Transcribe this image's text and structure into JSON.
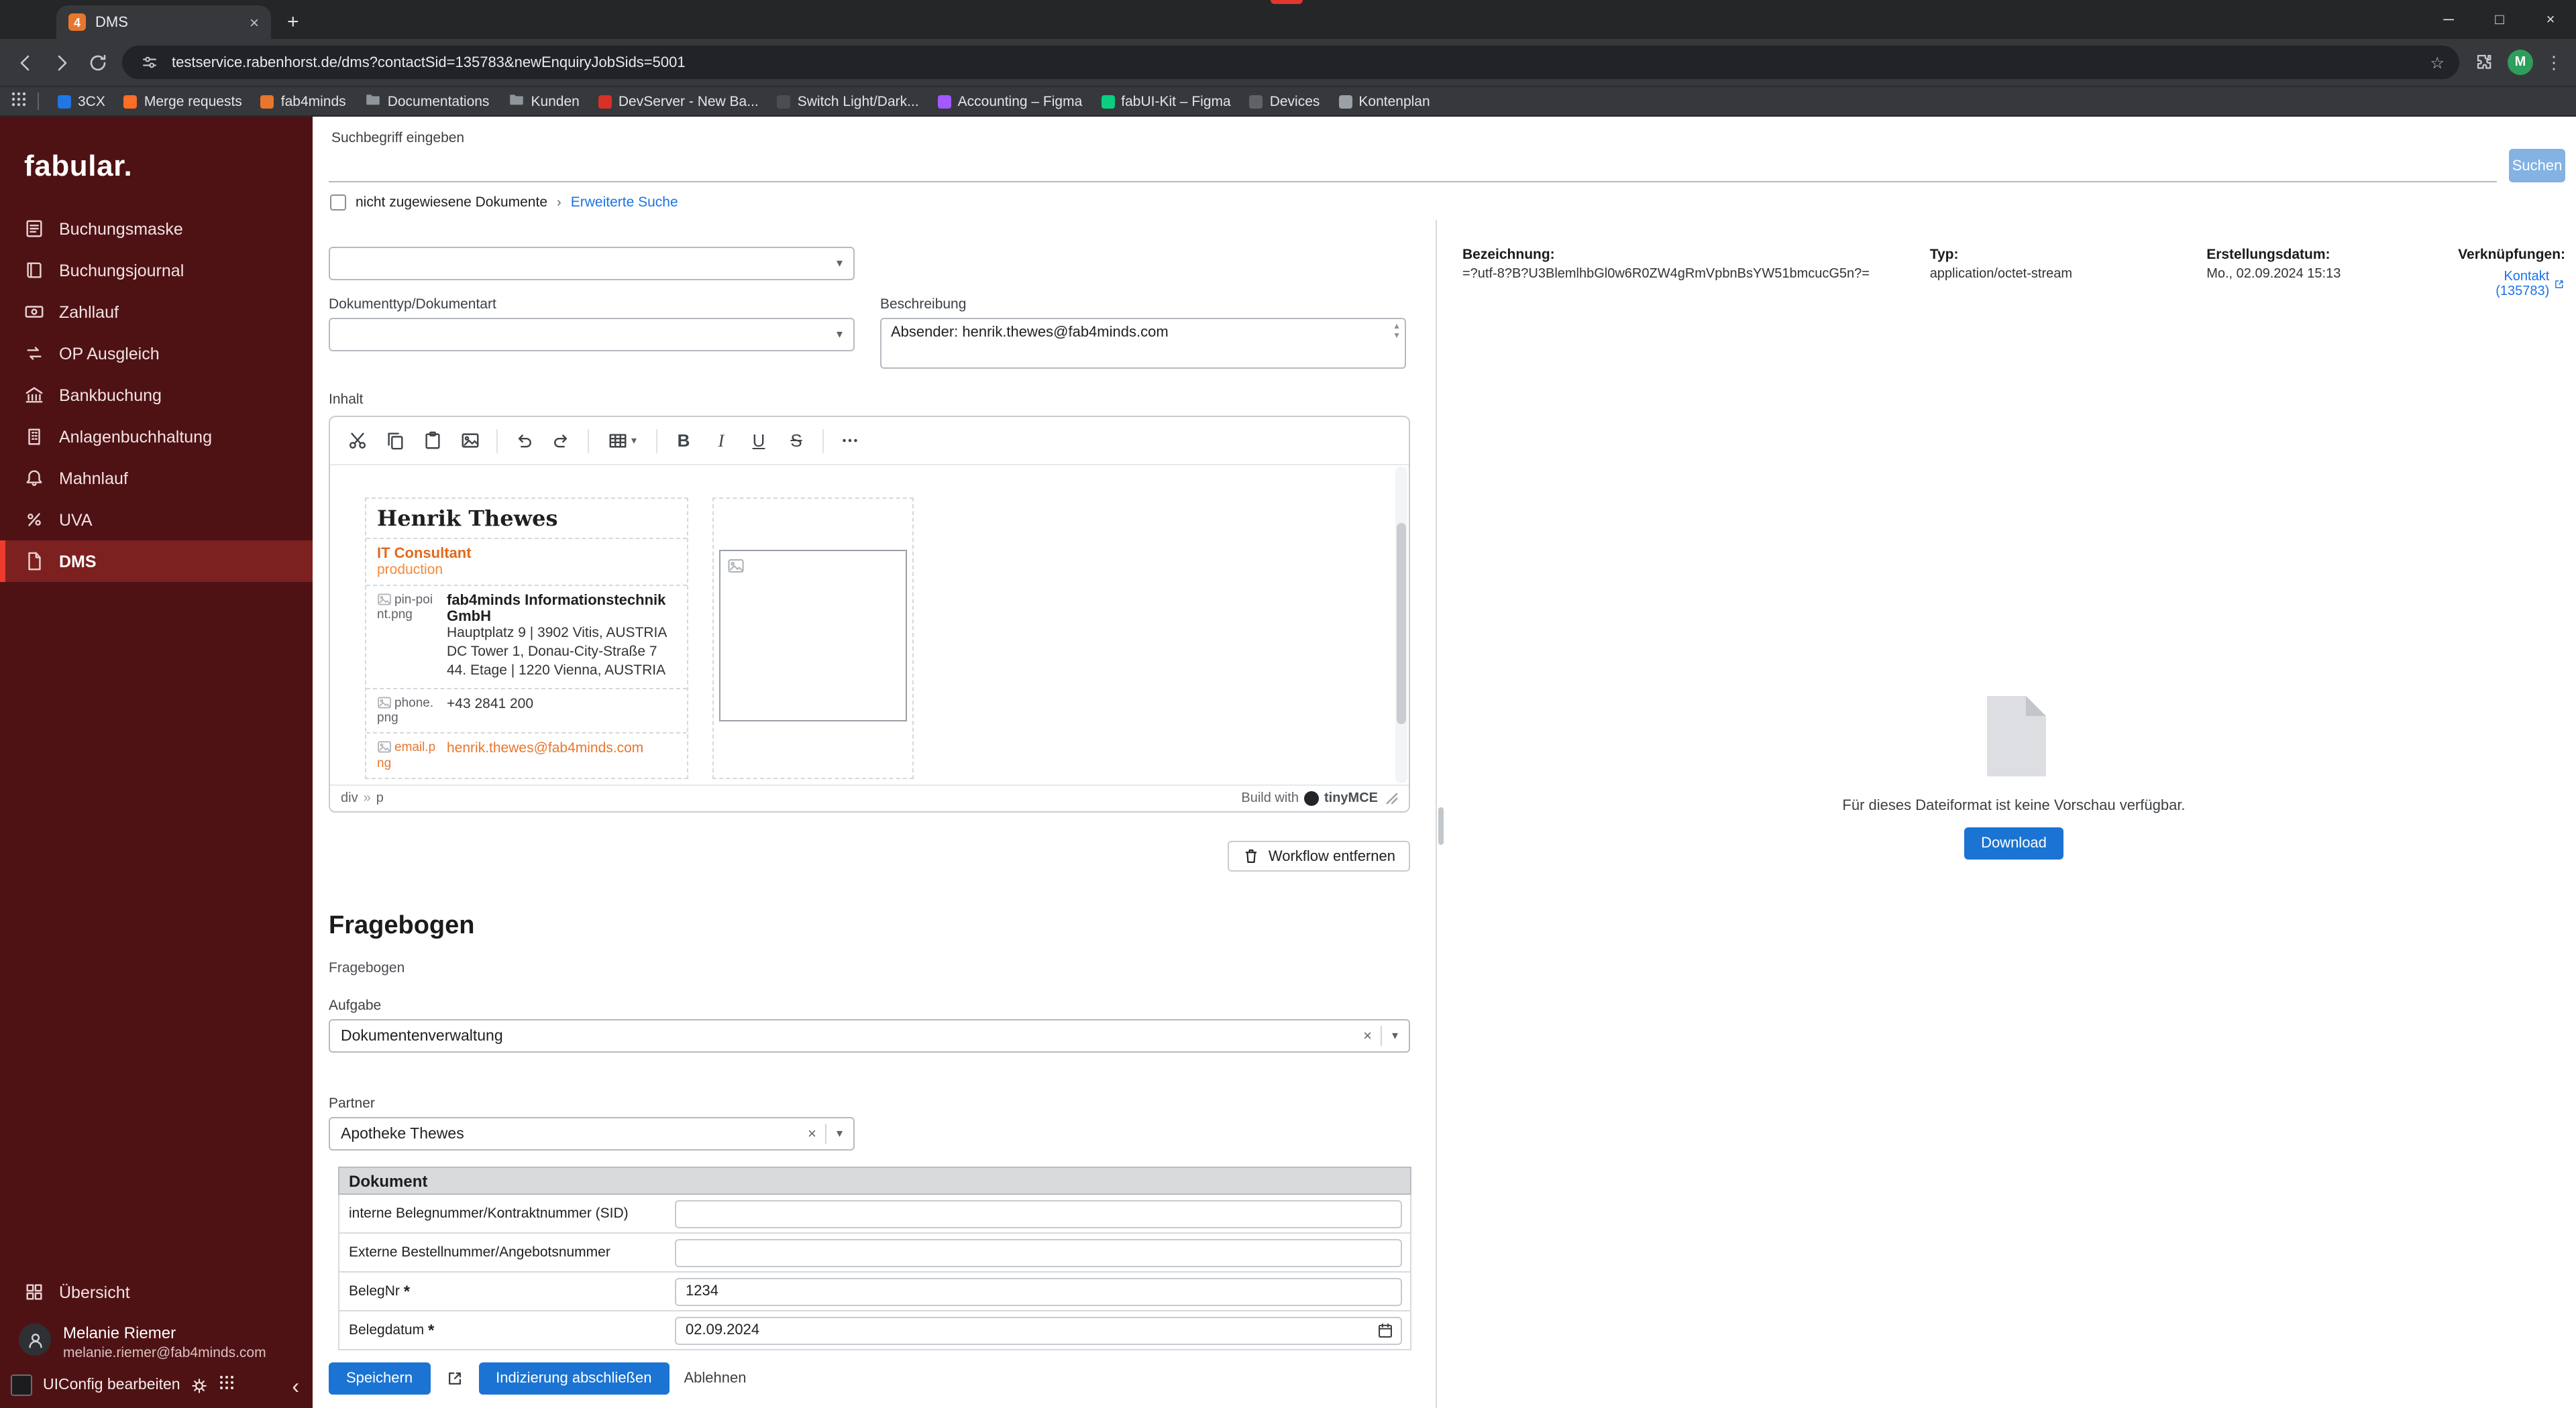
{
  "colors": {
    "sidebar_bg": "#4f1214",
    "sidebar_active_bg": "#7d2020",
    "accent_red": "#ee3b2f",
    "primary_blue": "#1b74d3",
    "link_blue": "#1a73e8",
    "signature_orange": "#e8762d",
    "chrome_dark": "#37383c"
  },
  "browser": {
    "tab_title": "DMS",
    "url": "testservice.rabenhorst.de/dms?contactSid=135783&newEnquiryJobSids=5001",
    "avatar_initial": "M",
    "favicon_letter": "4",
    "bookmarks": [
      {
        "label": "3CX",
        "color": "#2076e4",
        "icon": "site-icon"
      },
      {
        "label": "Merge requests",
        "color": "#fc6d26",
        "icon": "site-icon"
      },
      {
        "label": "fab4minds",
        "color": "#e8762d",
        "icon": "site-icon"
      },
      {
        "label": "Documentations",
        "color": "#8f959b",
        "icon": "folder-icon"
      },
      {
        "label": "Kunden",
        "color": "#8f959b",
        "icon": "folder-icon"
      },
      {
        "label": "DevServer - New Ba...",
        "color": "#d93025",
        "icon": "site-icon"
      },
      {
        "label": "Switch Light/Dark...",
        "color": "#4a4d52",
        "icon": "site-icon"
      },
      {
        "label": "Accounting – Figma",
        "color": "#a259ff",
        "icon": "site-icon"
      },
      {
        "label": "fabUI-Kit – Figma",
        "color": "#0acf83",
        "icon": "site-icon"
      },
      {
        "label": "Devices",
        "color": "#5f6368",
        "icon": "site-icon"
      },
      {
        "label": "Kontenplan",
        "color": "#9aa0a6",
        "icon": "site-icon"
      }
    ]
  },
  "sidebar": {
    "logo": "fabular.",
    "items": [
      {
        "label": "Buchungsmaske",
        "icon": "form-icon"
      },
      {
        "label": "Buchungsjournal",
        "icon": "journal-icon"
      },
      {
        "label": "Zahllauf",
        "icon": "payment-icon"
      },
      {
        "label": "OP Ausgleich",
        "icon": "balance-icon"
      },
      {
        "label": "Bankbuchung",
        "icon": "bank-icon"
      },
      {
        "label": "Anlagenbuchhaltung",
        "icon": "assets-icon"
      },
      {
        "label": "Mahnlauf",
        "icon": "bell-icon"
      },
      {
        "label": "UVA",
        "icon": "percent-icon"
      },
      {
        "label": "DMS",
        "icon": "file-icon"
      }
    ],
    "overview_label": "Übersicht",
    "user": {
      "name": "Melanie Riemer",
      "email": "melanie.riemer@fab4minds.com"
    },
    "uiconfig_label": "UIConfig bearbeiten"
  },
  "search": {
    "label": "Suchbegriff eingeben",
    "button_label": "Suchen",
    "unassigned_label": "nicht zugewiesene Dokumente",
    "advanced_label": "Erweiterte Suche"
  },
  "form": {
    "doc_type_label": "Dokumenttyp/Dokumentart",
    "description_label": "Beschreibung",
    "description_value": "Absender: henrik.thewes@fab4minds.com",
    "content_label": "Inhalt"
  },
  "editor": {
    "toolbar_icons": [
      "cut",
      "copy",
      "paste",
      "insert-image",
      "undo",
      "redo",
      "table",
      "bold",
      "italic",
      "underline",
      "strikethrough",
      "more-options"
    ],
    "signature": {
      "name": "Henrik Thewes",
      "role": "IT Consultant",
      "team": "production",
      "pin_alt": "pin-point.png",
      "company": "fab4minds Informationstechnik GmbH",
      "address1": "Hauptplatz 9 | 3902 Vitis, AUSTRIA",
      "address2": "DC Tower 1, Donau-City-Straße 7",
      "address3": "44. Etage | 1220 Vienna, AUSTRIA",
      "phone_alt": "phone.png",
      "phone": "+43 2841 200",
      "email_alt": "email.png",
      "email": "henrik.thewes@fab4minds.com"
    },
    "element_path": [
      "div",
      "p"
    ],
    "path_separator": "»",
    "branding_prefix": "Build with",
    "branding_name": "tinyMCE"
  },
  "workflow": {
    "remove_label": "Workflow entfernen"
  },
  "questionnaire": {
    "heading": "Fragebogen",
    "sub_label": "Fragebogen",
    "task_label": "Aufgabe",
    "task_value": "Dokumentenverwaltung",
    "partner_label": "Partner",
    "partner_value": "Apotheke Thewes"
  },
  "document_section": {
    "heading": "Dokument",
    "rows": [
      {
        "label": "interne Belegnummer/Kontraktnummer (SID)",
        "value": "",
        "required_mark": ""
      },
      {
        "label": "Externe Bestellnummer/Angebotsnummer",
        "value": "",
        "required_mark": ""
      },
      {
        "label": "BelegNr",
        "value": "1234",
        "required_mark": "*"
      },
      {
        "label": "Belegdatum",
        "value": "02.09.2024",
        "required_mark": "*"
      }
    ]
  },
  "actions": {
    "save": "Speichern",
    "complete_indexing": "Indizierung abschließen",
    "reject": "Ablehnen"
  },
  "preview": {
    "meta": [
      {
        "label": "Bezeichnung:",
        "value": "=?utf-8?B?U3BlemlhbGl0w6R0ZW4gRmVpbnBsYW51bmcucG5n?="
      },
      {
        "label": "Typ:",
        "value": "application/octet-stream"
      },
      {
        "label": "Erstellungsdatum:",
        "value": "Mo., 02.09.2024 15:13"
      },
      {
        "label": "Verknüpfungen:",
        "value": "Kontakt (135783)"
      }
    ],
    "no_preview": "Für dieses Dateiformat ist keine Vorschau verfügbar.",
    "download": "Download"
  }
}
